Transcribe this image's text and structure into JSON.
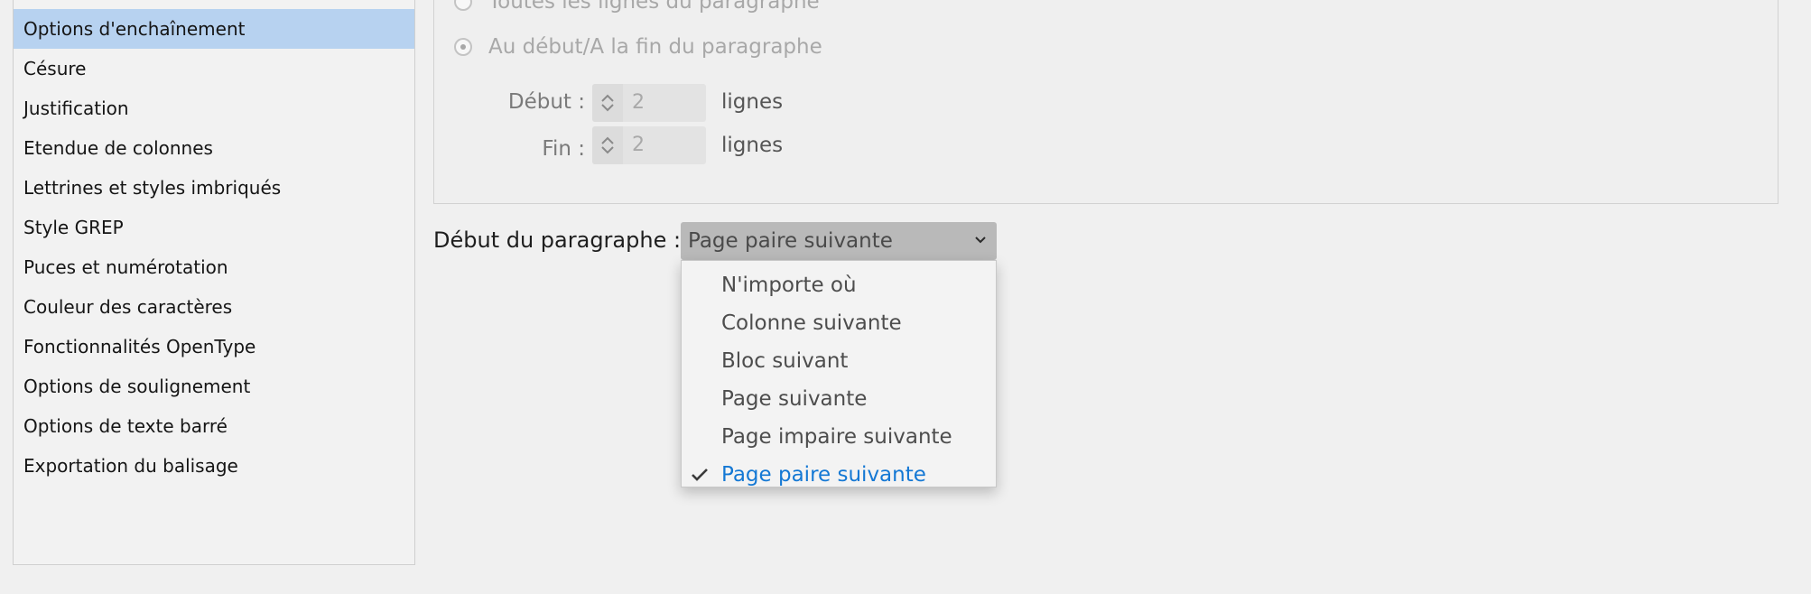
{
  "sidebar": {
    "items": [
      {
        "label": "Options d'enchaînement",
        "selected": true
      },
      {
        "label": "Césure"
      },
      {
        "label": "Justification"
      },
      {
        "label": "Etendue de colonnes"
      },
      {
        "label": "Lettrines et styles imbriqués"
      },
      {
        "label": "Style GREP"
      },
      {
        "label": "Puces et numérotation"
      },
      {
        "label": "Couleur des caractères"
      },
      {
        "label": "Fonctionnalités OpenType"
      },
      {
        "label": "Options de soulignement"
      },
      {
        "label": "Options de texte barré"
      },
      {
        "label": "Exportation du balisage"
      }
    ]
  },
  "keep_options": {
    "radio_all_lines": "Toutes les lignes du paragraphe",
    "radio_start_end": "Au début/A la fin du paragraphe",
    "start_label": "Début :",
    "start_value": "2",
    "end_label": "Fin :",
    "end_value": "2",
    "unit": "lignes"
  },
  "paragraph_start": {
    "label": "Début du paragraphe :",
    "selected": "Page paire suivante",
    "options": [
      "N'importe où",
      "Colonne suivante",
      "Bloc suivant",
      "Page suivante",
      "Page impaire suivante",
      "Page paire suivante"
    ]
  },
  "colors": {
    "selection_bg": "#b7d2f0",
    "menu_selected_text": "#1478d4"
  },
  "icons": [
    "check-icon",
    "chevron-down-icon",
    "chevron-up-icon"
  ]
}
